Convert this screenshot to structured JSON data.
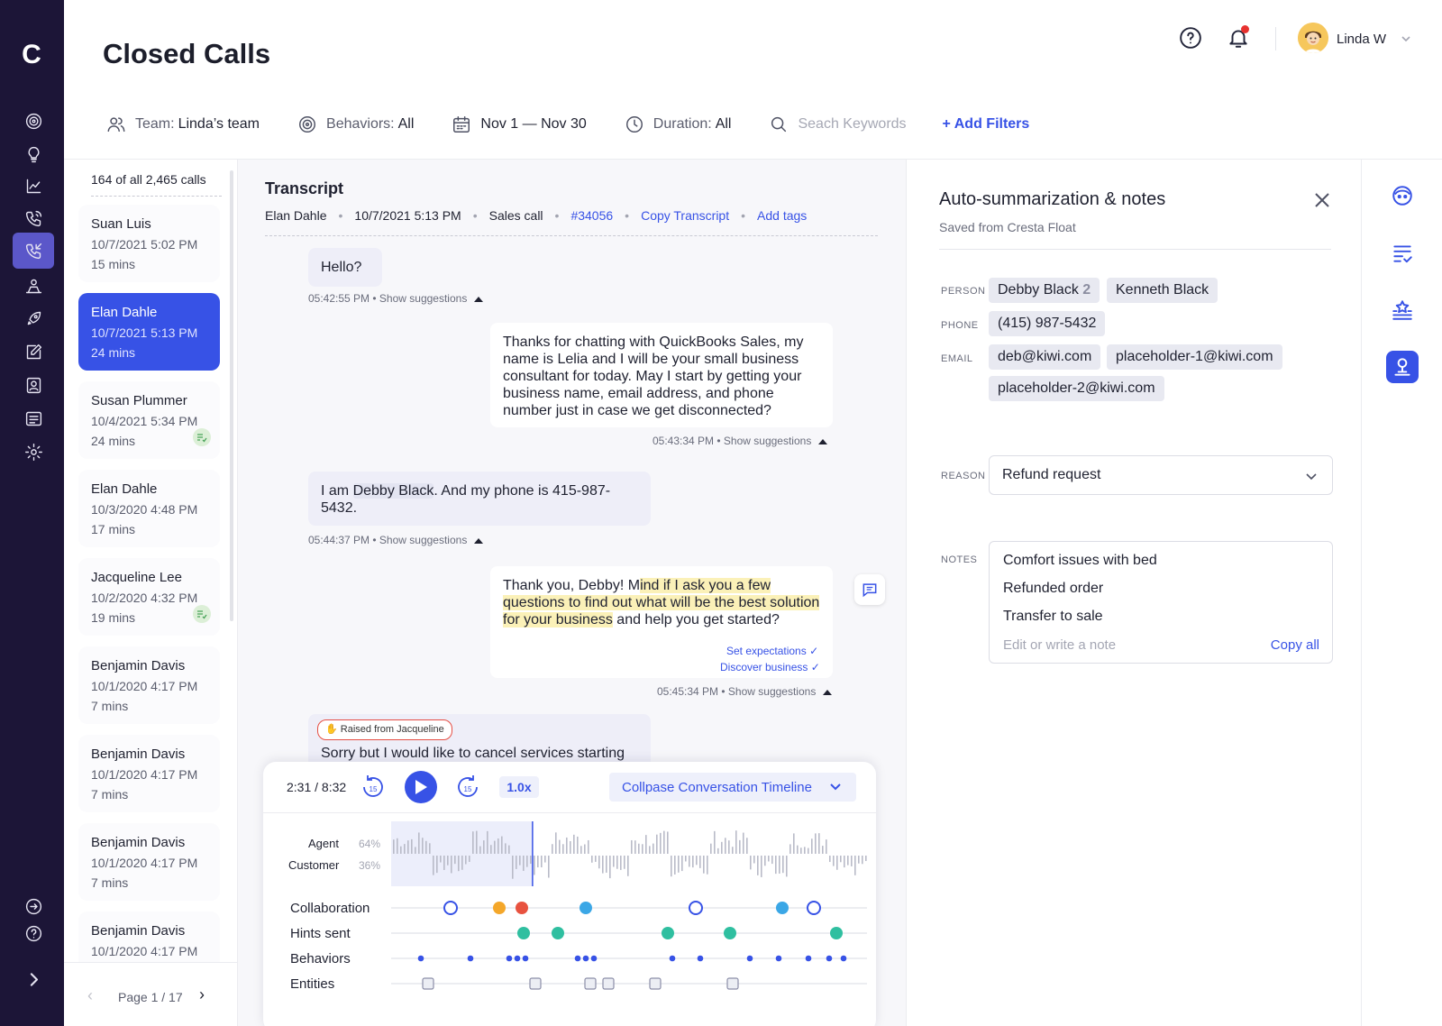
{
  "app": {
    "logo_letter": "C"
  },
  "page": {
    "title": "Closed Calls"
  },
  "header": {
    "user_name": "Linda W"
  },
  "filters": {
    "team_label": "Team:",
    "team_value": "Linda’s team",
    "behaviors_label": "Behaviors:",
    "behaviors_value": "All",
    "date_value": "Nov 1 — Nov 30",
    "duration_label": "Duration:",
    "duration_value": "All",
    "search_placeholder": "Seach Keywords",
    "add_filters": "+  Add Filters"
  },
  "calls": {
    "count": "164 of all 2,465 calls",
    "items": [
      {
        "name": "Suan Luis",
        "date": "10/7/2021 5:02 PM",
        "duration": "15 mins"
      },
      {
        "name": "Elan Dahle",
        "date": "10/7/2021 5:13 PM",
        "duration": "24 mins"
      },
      {
        "name": "Susan Plummer",
        "date": "10/4/2021 5:34 PM",
        "duration": "24 mins"
      },
      {
        "name": "Elan Dahle",
        "date": "10/3/2020 4:48 PM",
        "duration": "17 mins"
      },
      {
        "name": "Jacqueline Lee",
        "date": "10/2/2020 4:32 PM",
        "duration": "19 mins"
      },
      {
        "name": "Benjamin Davis",
        "date": "10/1/2020 4:17 PM",
        "duration": "7 mins"
      },
      {
        "name": "Benjamin Davis",
        "date": "10/1/2020 4:17 PM",
        "duration": "7 mins"
      },
      {
        "name": "Benjamin Davis",
        "date": "10/1/2020 4:17 PM",
        "duration": "7 mins"
      },
      {
        "name": "Benjamin Davis",
        "date": "10/1/2020 4:17 PM",
        "duration": ""
      }
    ],
    "page_label": "Page 1 / 17"
  },
  "transcript": {
    "title": "Transcript",
    "meta": {
      "agent": "Elan Dahle",
      "datetime": "10/7/2021 5:13 PM",
      "type": "Sales call",
      "id": "#34056",
      "copy": "Copy Transcript",
      "tags": "Add tags"
    },
    "show_suggestions": "Show suggestions",
    "messages": [
      {
        "time": "05:42:55 PM",
        "text": "Hello?"
      },
      {
        "time": "05:43:34 PM",
        "text": "Thanks for chatting with QuickBooks Sales, my name is Lelia and I will be your small business consultant for today. May I start by getting your business name, email address, and phone number just in case we get disconnected?"
      },
      {
        "time": "05:44:37 PM",
        "before": "I am ",
        "entity": "Debby Black",
        "after": ". And my phone is 415-987-5432."
      },
      {
        "time": "05:45:34 PM",
        "before": "Thank you, Debby! M",
        "highlight": "ind if I ask you a few questions to find out what will be the best solution for your business",
        "after": " and help you get started?",
        "suggestions": [
          "Set expectations",
          "Discover business"
        ]
      },
      {
        "raised": "Raised from Jacqueline",
        "text": "Sorry but I would like to cancel services starting"
      }
    ]
  },
  "player": {
    "time": "2:31 / 8:32",
    "rewind": "15",
    "forward": "15",
    "speed": "1.0x",
    "collapse": "Collpase Conversation Timeline",
    "agent_label": "Agent",
    "agent_pct": "64%",
    "customer_label": "Customer",
    "customer_pct": "36%",
    "progress": 0.296,
    "rows": [
      "Collaboration",
      "Hints sent",
      "Behaviors",
      "Entities"
    ]
  },
  "summary": {
    "title": "Auto-summarization & notes",
    "subtitle": "Saved from Cresta Float",
    "person_label": "PERSON",
    "person_1": "Debby Black",
    "person_1_count": "2",
    "person_2": "Kenneth Black",
    "phone_label": "PHONE",
    "phone": "(415) 987-5432",
    "email_label": "EMAIL",
    "email_1": "deb@kiwi.com",
    "email_2": "placeholder-1@kiwi.com",
    "email_3": "placeholder-2@kiwi.com",
    "reason_label": "REASON",
    "reason_value": "Refund request",
    "notes_label": "NOTES",
    "notes": [
      "Comfort issues with bed",
      "Refunded order",
      "Transfer to sale"
    ],
    "note_placeholder": "Edit or write a note",
    "copy_all": "Copy all"
  },
  "colors": {
    "accent": "#3752e6",
    "nav_bg": "#1c1537",
    "highlight": "#fbf1b8",
    "hint_teal": "#2fbfa0",
    "collab_red": "#e8523f"
  }
}
